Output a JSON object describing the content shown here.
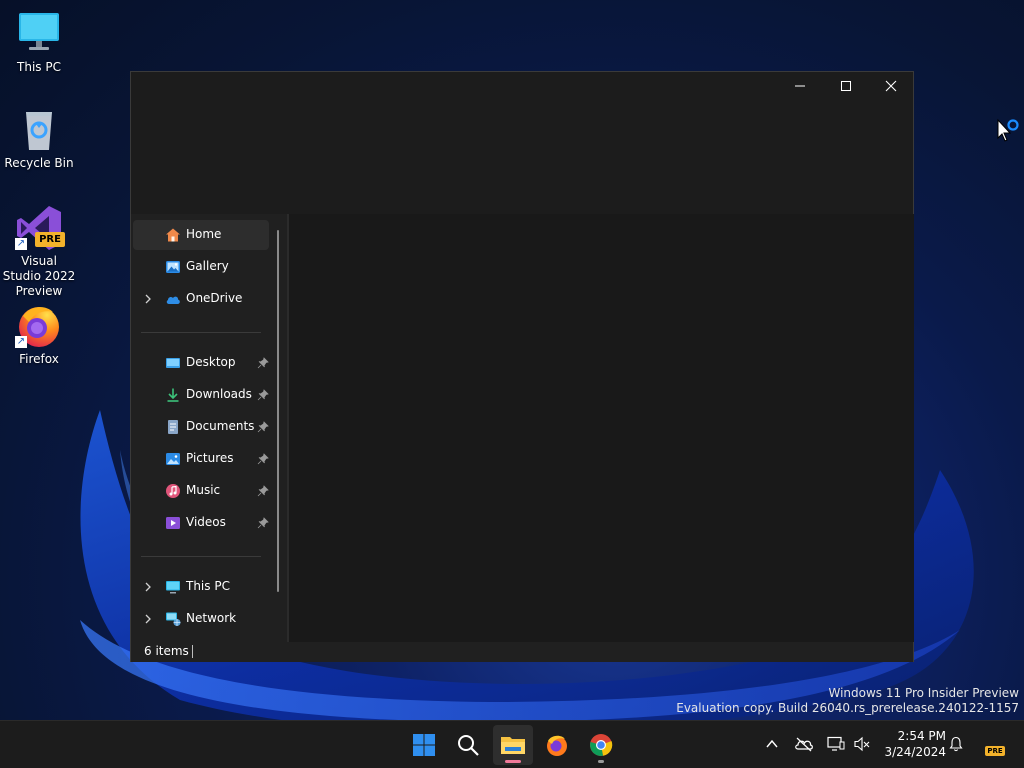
{
  "desktop": {
    "icons": [
      {
        "label": "This PC"
      },
      {
        "label": "Recycle Bin"
      },
      {
        "label": "Visual Studio 2022 Preview",
        "badge": "PRE"
      },
      {
        "label": "Firefox"
      }
    ]
  },
  "explorer": {
    "window_controls": {
      "minimize": "minimize-icon",
      "maximize": "maximize-icon",
      "close": "close-icon"
    },
    "nav": {
      "quick": [
        {
          "label": "Home",
          "icon": "home-icon",
          "selected": true
        },
        {
          "label": "Gallery",
          "icon": "gallery-icon"
        },
        {
          "label": "OneDrive",
          "icon": "cloud-icon",
          "expandable": true
        }
      ],
      "pinned": [
        {
          "label": "Desktop",
          "icon": "desktop-folder-icon"
        },
        {
          "label": "Downloads",
          "icon": "download-icon"
        },
        {
          "label": "Documents",
          "icon": "document-icon"
        },
        {
          "label": "Pictures",
          "icon": "picture-icon"
        },
        {
          "label": "Music",
          "icon": "music-icon"
        },
        {
          "label": "Videos",
          "icon": "video-icon"
        }
      ],
      "locations": [
        {
          "label": "This PC",
          "icon": "computer-icon",
          "expandable": true
        },
        {
          "label": "Network",
          "icon": "network-icon",
          "expandable": true
        }
      ]
    },
    "status": {
      "items": "6 items"
    }
  },
  "watermark": {
    "line1": "Windows 11 Pro Insider Preview",
    "line2": "Evaluation copy. Build 26040.rs_prerelease.240122-1157"
  },
  "taskbar": {
    "apps": [
      "start-icon",
      "search-icon",
      "file-explorer-icon",
      "firefox-icon",
      "chrome-icon"
    ],
    "tray": [
      "chevron-up-icon",
      "onedrive-offline-icon",
      "display-icon",
      "speaker-muted-icon"
    ],
    "time": "2:54 PM",
    "date": "3/24/2024",
    "notification_icon": "bell-icon",
    "badge": "PRE"
  },
  "colors": {
    "accent": "#0078d4",
    "window_bg": "#202020",
    "content_bg": "#191919",
    "taskbar_bg": "#1c1c1c"
  }
}
